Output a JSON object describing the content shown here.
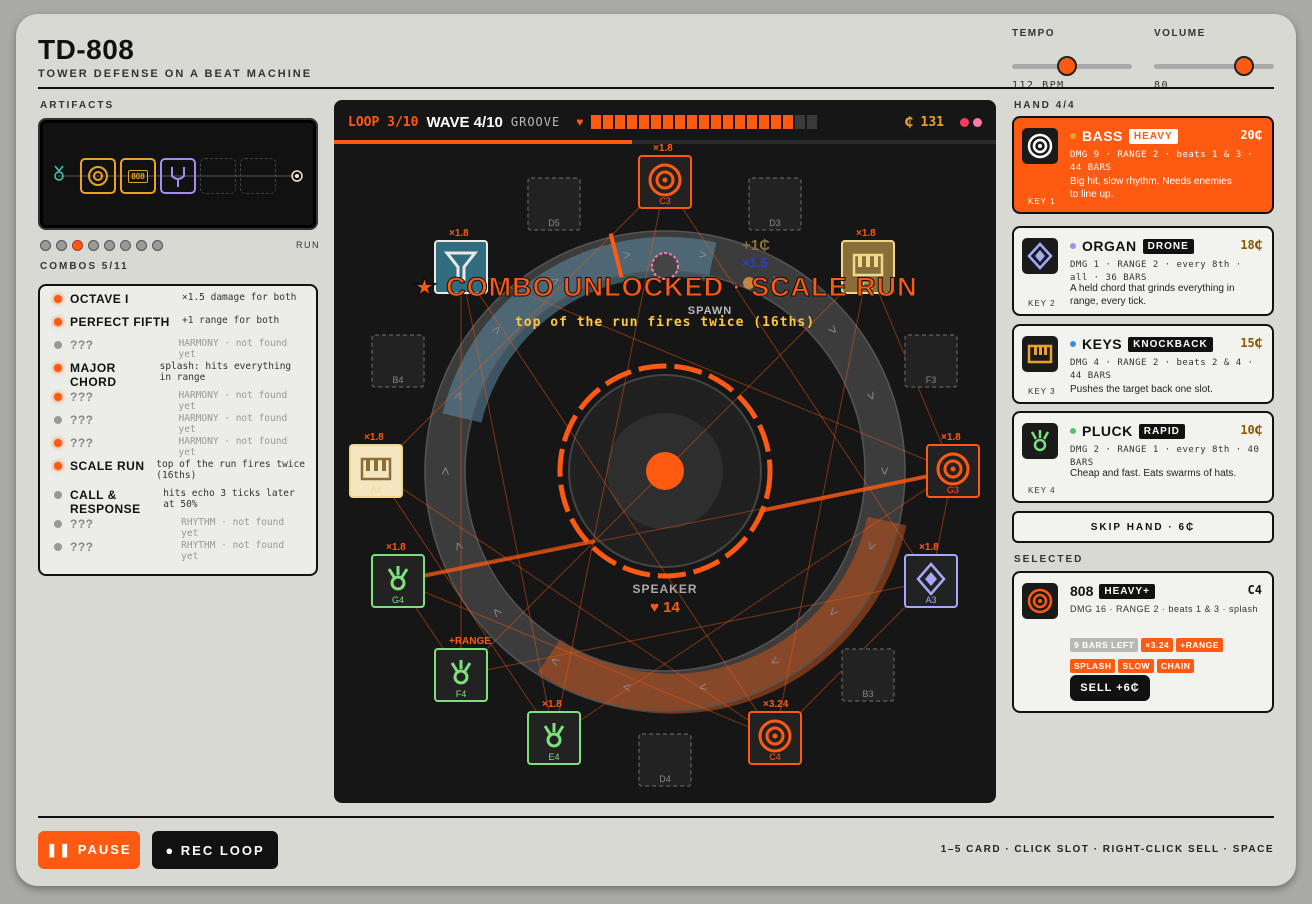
{
  "header": {
    "title": "TD-808",
    "subtitle": "TOWER DEFENSE ON A BEAT MACHINE"
  },
  "tempo": {
    "label": "TEMPO",
    "value": "112 BPM",
    "level": 0.45
  },
  "volume": {
    "label": "VOLUME",
    "value": "80",
    "level": 0.8
  },
  "artifacts": {
    "label": "ARTIFACTS",
    "run_label": "RUN",
    "leds_on_index": 2,
    "item_808": "808"
  },
  "combos": {
    "label": "COMBOS 5/11",
    "items": [
      {
        "name": "OCTAVE I",
        "desc": "×1.5 damage for both",
        "found": true
      },
      {
        "name": "PERFECT FIFTH",
        "desc": "+1 range for both",
        "found": true
      },
      {
        "name": "???",
        "desc": "HARMONY · not found yet",
        "found": false
      },
      {
        "name": "MAJOR CHORD",
        "desc": "splash: hits everything in range",
        "found": true
      },
      {
        "name": "???",
        "desc": "HARMONY · not found yet",
        "found": false,
        "lit": true
      },
      {
        "name": "???",
        "desc": "HARMONY · not found yet",
        "found": false
      },
      {
        "name": "???",
        "desc": "HARMONY · not found yet",
        "found": false,
        "lit": true
      },
      {
        "name": "SCALE RUN",
        "desc": "top of the run fires twice (16ths)",
        "found": true
      },
      {
        "name": "CALL & RESPONSE",
        "desc": "hits echo 3 ticks later at 50%",
        "found": true,
        "dim": true
      },
      {
        "name": "???",
        "desc": "RHYTHM · not found yet",
        "found": false
      },
      {
        "name": "???",
        "desc": "RHYTHM · not found yet",
        "found": false
      }
    ]
  },
  "board": {
    "loop": "LOOP 3/10",
    "wave": "WAVE 4/10",
    "groove": "GROOVE",
    "coins": "₵ 131",
    "groove_segments": {
      "total": 19,
      "filled": 17
    },
    "progress": 0.45,
    "combo_banner": "★ COMBO UNLOCKED · SCALE RUN",
    "combo_sub": "top of the run fires twice (16ths)",
    "spawn": "SPAWN",
    "speaker": "SPEAKER",
    "hp": "♥ 14",
    "float_coin": "+1₵",
    "float_mult": "×1.5",
    "towers": [
      {
        "note": "C3",
        "mult": "×1.8",
        "type": "bass"
      },
      {
        "note": "D3",
        "empty": true
      },
      {
        "note": "E3",
        "mult": "×1.8",
        "type": "keys"
      },
      {
        "note": "F3",
        "empty": true
      },
      {
        "note": "G3",
        "mult": "×1.8",
        "type": "bass"
      },
      {
        "note": "A3",
        "mult": "×1.8",
        "type": "organ"
      },
      {
        "note": "B3",
        "empty": true
      },
      {
        "note": "C4",
        "mult": "×3.24",
        "type": "bass"
      },
      {
        "note": "D4",
        "empty": true
      },
      {
        "note": "E4",
        "mult": "×1.8",
        "type": "pluck"
      },
      {
        "note": "F4",
        "mult": "+RANGE",
        "type": "pluck"
      },
      {
        "note": "G4",
        "mult": "×1.8",
        "type": "pluck"
      },
      {
        "note": "A4",
        "mult": "×1.8",
        "type": "keys"
      },
      {
        "note": "B4",
        "empty": true
      },
      {
        "note": "",
        "mult": "×1.8",
        "type": "filter"
      },
      {
        "note": "D5",
        "empty": true
      }
    ]
  },
  "hand": {
    "label": "HAND 4/4",
    "cards": [
      {
        "name": "BASS",
        "tag": "HEAVY",
        "cost": "20₵",
        "stats": "DMG 9 · RANGE 2 · beats 1 & 3 · 44 BARS",
        "desc": "Big hit, slow rhythm. Needs enemies to line up.",
        "key": "KEY 1",
        "color": "#e8a224"
      },
      {
        "name": "ORGAN",
        "tag": "DRONE",
        "cost": "18₵",
        "stats": "DMG 1 · RANGE 2 · every 8th · all · 36 BARS",
        "desc": "A held chord that grinds everything in range, every tick.",
        "key": "KEY 2",
        "color": "#a58cf0"
      },
      {
        "name": "KEYS",
        "tag": "KNOCKBACK",
        "cost": "15₵",
        "stats": "DMG 4 · RANGE 2 · beats 2 & 4 · 44 BARS",
        "desc": "Pushes the target back one slot.",
        "key": "KEY 3",
        "color": "#3a8ee8"
      },
      {
        "name": "PLUCK",
        "tag": "RAPID",
        "cost": "10₵",
        "stats": "DMG 2 · RANGE 1 · every 8th · 40 BARS",
        "desc": "Cheap and fast. Eats swarms of hats.",
        "key": "KEY 4",
        "color": "#4cc46a"
      }
    ]
  },
  "skip": "SKIP HAND · 6₵",
  "selected": {
    "label": "SELECTED",
    "name": "808",
    "tag": "HEAVY+",
    "note": "C4",
    "stats": "DMG 16 · RANGE 2 · beats 1 & 3 · splash",
    "chips": [
      "9 BARS LEFT",
      "×3.24",
      "+RANGE",
      "SPLASH",
      "SLOW",
      "CHAIN"
    ],
    "sell": "SELL +6₵"
  },
  "footer": {
    "pause": "❚❚ PAUSE",
    "rec": "● REC LOOP",
    "hints": "1–5 CARD · CLICK SLOT · RIGHT-CLICK SELL · SPACE"
  },
  "colors": {
    "accent": "#ff5a12",
    "bass": "#ff5a12",
    "keys": "#f0d88a",
    "organ": "#a8a8ff",
    "pluck": "#7ee07e",
    "filter": "#e8e8e8"
  }
}
